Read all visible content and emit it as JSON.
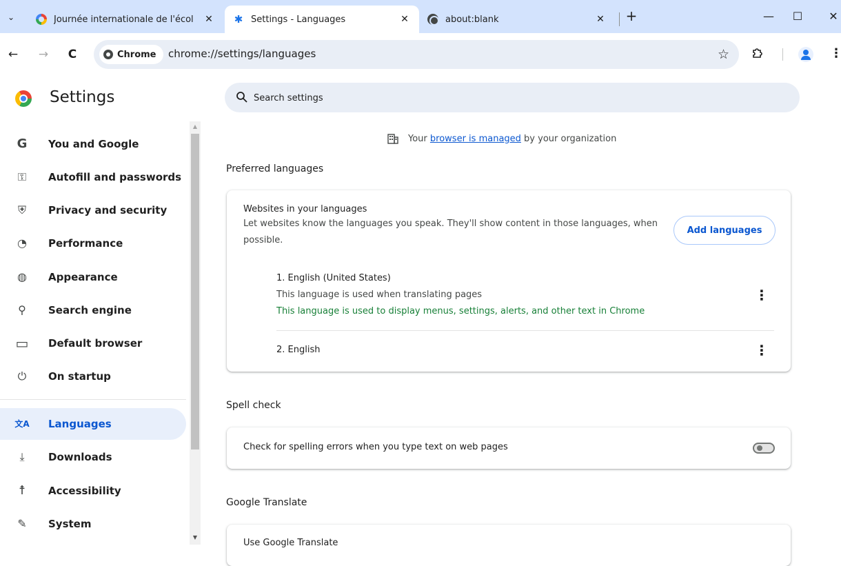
{
  "browser": {
    "tabs": [
      {
        "title": "Journée internationale de l'écol",
        "close": "✕"
      },
      {
        "title": "Settings - Languages",
        "close": "✕",
        "active": true
      },
      {
        "title": "about:blank",
        "close": "✕"
      }
    ],
    "tab_search_glyph": "⌄",
    "new_tab_glyph": "+",
    "window_controls": {
      "minimize": "—",
      "maximize": "☐",
      "close": "✕"
    },
    "toolbar": {
      "back": "←",
      "forward": "→",
      "reload": "C",
      "chip_label": "Chrome",
      "url": "chrome://settings/languages",
      "bookmark_star": "☆",
      "menu": "⋮"
    }
  },
  "settings": {
    "title": "Settings",
    "search_placeholder": "Search settings",
    "sidebar": [
      {
        "label": "You and Google",
        "icon": "google-icon",
        "glyph": "G"
      },
      {
        "label": "Autofill and passwords",
        "icon": "key-icon",
        "glyph": "⚿"
      },
      {
        "label": "Privacy and security",
        "icon": "shield-icon",
        "glyph": "⛨"
      },
      {
        "label": "Performance",
        "icon": "speedometer-icon",
        "glyph": "◔"
      },
      {
        "label": "Appearance",
        "icon": "palette-icon",
        "glyph": "◍"
      },
      {
        "label": "Search engine",
        "icon": "search-icon",
        "glyph": "⚲"
      },
      {
        "label": "Default browser",
        "icon": "browser-window-icon",
        "glyph": "▭"
      },
      {
        "label": "On startup",
        "icon": "power-icon",
        "glyph": "⏻"
      },
      {
        "label": "Languages",
        "icon": "translate-icon",
        "glyph": "文A",
        "active": true
      },
      {
        "label": "Downloads",
        "icon": "download-icon",
        "glyph": "⤓"
      },
      {
        "label": "Accessibility",
        "icon": "accessibility-icon",
        "glyph": "☨"
      },
      {
        "label": "System",
        "icon": "wrench-icon",
        "glyph": "✎"
      }
    ],
    "managed_notice": {
      "prefix": "Your",
      "link": "browser is managed",
      "suffix": "by your organization"
    },
    "preferred_languages": {
      "heading": "Preferred languages",
      "websites_title": "Websites in your languages",
      "websites_desc": "Let websites know the languages you speak. They'll show content in those languages, when possible.",
      "add_button": "Add languages",
      "languages": [
        {
          "name": "1. English (United States)",
          "note": "This language is used when translating pages",
          "ui_note": "This language is used to display menus, settings, alerts, and other text in Chrome"
        },
        {
          "name": "2. English"
        }
      ]
    },
    "spell_check": {
      "heading": "Spell check",
      "label": "Check for spelling errors when you type text on web pages",
      "enabled": false
    },
    "google_translate": {
      "heading": "Google Translate",
      "use_label": "Use Google Translate"
    }
  }
}
